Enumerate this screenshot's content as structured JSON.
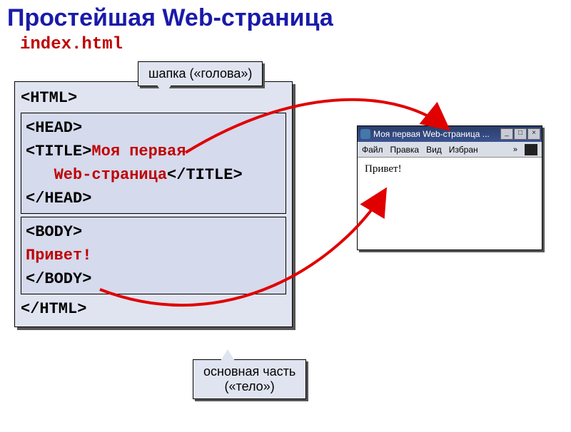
{
  "heading": "Простейшая Web-страница",
  "filename": "index.html",
  "code": {
    "html_open": "<HTML>",
    "head_open": "<HEAD>",
    "title_open": "<TITLE>",
    "title_text1": "Моя первая",
    "title_text2_indent": "   ",
    "title_text2": "Web-страница",
    "title_close": "</TITLE>",
    "head_close": "</HEAD>",
    "body_open": "<BODY>",
    "body_text": "Привет!",
    "body_close": "</BODY>",
    "html_close": "</HTML>"
  },
  "callouts": {
    "head": "шапка («голова»)",
    "body_line1": "основная часть",
    "body_line2": "(«тело»)"
  },
  "browser": {
    "title": "Моя первая Web-страница ...",
    "menu": {
      "file": "Файл",
      "edit": "Правка",
      "view": "Вид",
      "fav": "Избран",
      "chev": "»"
    },
    "win": {
      "min": "_",
      "max": "□",
      "close": "×"
    },
    "content": "Привет!"
  }
}
